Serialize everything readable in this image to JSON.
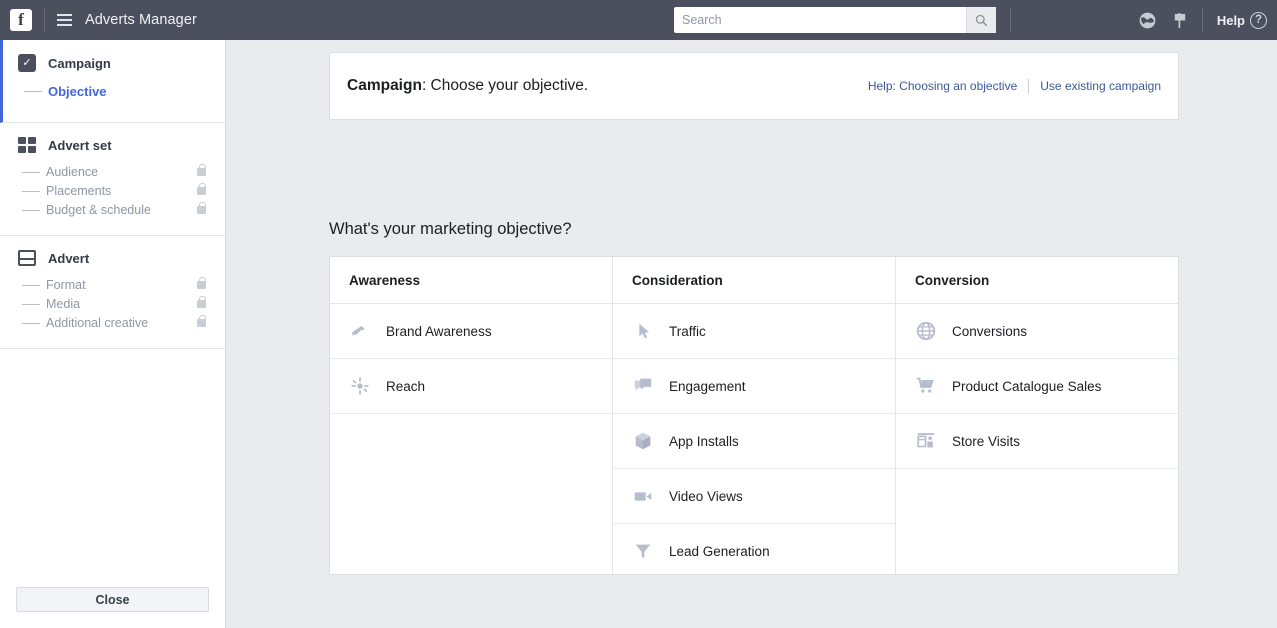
{
  "topbar": {
    "logo": "f",
    "logo_icon": "facebook-logo",
    "menu_icon": "hamburger-menu-icon",
    "app_title": "Adverts Manager",
    "search_placeholder": "Search",
    "search_value": "",
    "search_icon": "search-icon",
    "globe_icon": "globe-icon",
    "flag_icon": "flag-icon",
    "help_label": "Help",
    "help_icon": "question-mark-icon"
  },
  "sidebar": {
    "blocks": [
      {
        "title": "Campaign",
        "icon": "checkbox-checked-icon",
        "active": true,
        "items": [
          {
            "label": "Objective",
            "active": true,
            "locked": false
          }
        ]
      },
      {
        "title": "Advert set",
        "icon": "grid-icon",
        "active": false,
        "items": [
          {
            "label": "Audience",
            "active": false,
            "locked": true
          },
          {
            "label": "Placements",
            "active": false,
            "locked": true
          },
          {
            "label": "Budget & schedule",
            "active": false,
            "locked": true
          }
        ]
      },
      {
        "title": "Advert",
        "icon": "advert-layout-icon",
        "active": false,
        "items": [
          {
            "label": "Format",
            "active": false,
            "locked": true
          },
          {
            "label": "Media",
            "active": false,
            "locked": true
          },
          {
            "label": "Additional creative",
            "active": false,
            "locked": true
          }
        ]
      }
    ],
    "close_label": "Close"
  },
  "campaign_bar": {
    "title_bold": "Campaign",
    "title_rest": ": Choose your objective.",
    "help_link": "Help: Choosing an objective",
    "existing_link": "Use existing campaign"
  },
  "main": {
    "section_title": "What's your marketing objective?",
    "columns": [
      {
        "header": "Awareness",
        "items": [
          {
            "label": "Brand Awareness",
            "icon": "megaphone-icon"
          },
          {
            "label": "Reach",
            "icon": "burst-icon"
          }
        ]
      },
      {
        "header": "Consideration",
        "items": [
          {
            "label": "Traffic",
            "icon": "cursor-icon"
          },
          {
            "label": "Engagement",
            "icon": "speech-bubbles-icon"
          },
          {
            "label": "App Installs",
            "icon": "cube-icon"
          },
          {
            "label": "Video Views",
            "icon": "video-camera-icon"
          },
          {
            "label": "Lead Generation",
            "icon": "funnel-icon"
          }
        ]
      },
      {
        "header": "Conversion",
        "items": [
          {
            "label": "Conversions",
            "icon": "globe-icon"
          },
          {
            "label": "Product Catalogue Sales",
            "icon": "shopping-cart-icon"
          },
          {
            "label": "Store Visits",
            "icon": "storefront-icon"
          }
        ]
      }
    ]
  },
  "colors": {
    "topbar": "#4b4f5e",
    "page_bg": "#e9ebee",
    "accent_blue": "#4267dd",
    "link_blue": "#3b5998",
    "objective_icon": "#b7bdcd"
  }
}
